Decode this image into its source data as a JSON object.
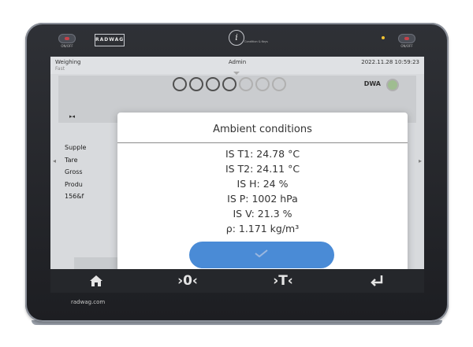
{
  "device": {
    "logo_text": "RADWAG",
    "left_button_caption": "ON/OFF",
    "right_button_caption": "ON/OFF",
    "info_button_glyph": "i",
    "info_caption": "Condition & Keys",
    "brand_url": "radwag.com"
  },
  "status_bar": {
    "mode": "Weighing",
    "sub_mode": "Fast",
    "user": "Admin",
    "datetime": "2022.11.28 10:59:23"
  },
  "weighing": {
    "dwa_label": "DWA",
    "zero_symbol": "▸◂",
    "level_icon": "drops-icon"
  },
  "info_panel": {
    "lines": [
      "Supple",
      "Tare",
      "Gross",
      "Produ",
      "156&f"
    ]
  },
  "dialog": {
    "title": "Ambient conditions",
    "readings": [
      "IS T1: 24.78 °C",
      "IS T2: 24.11 °C",
      "IS H: 24 %",
      "IS P: 1002 hPa",
      "IS V: 21.3 %",
      "ρ: 1.171 kg/m³"
    ],
    "ok_icon": "check-icon"
  },
  "nav": {
    "home_icon": "home-icon",
    "zero_glyph": "›0‹",
    "tare_glyph": "›T‹",
    "enter_icon": "enter-icon"
  },
  "colors": {
    "accent_button": "#4a8bd6",
    "frame": "#25272b",
    "screen_bg": "#e6e8eb",
    "led": "#f1c232",
    "stability": "#3a9a3a"
  }
}
